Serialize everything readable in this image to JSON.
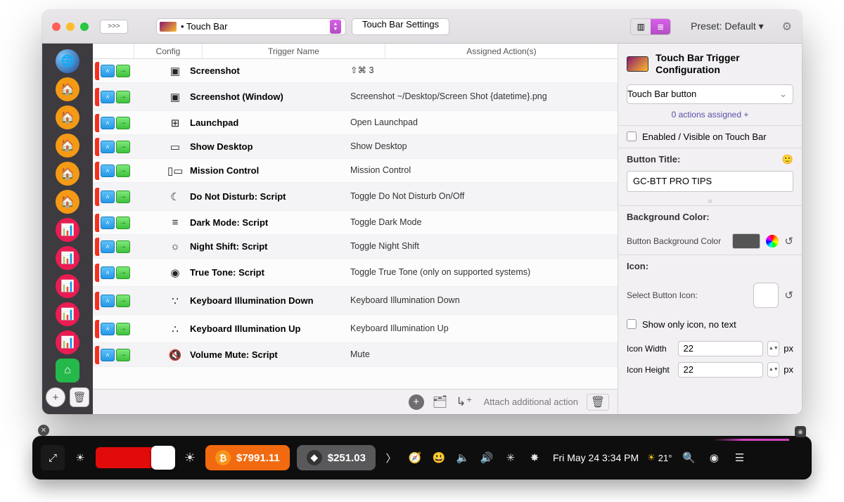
{
  "titlebar": {
    "show_more": ">>>",
    "touchbar_dropdown": "• Touch Bar",
    "settings_button": "Touch Bar Settings",
    "preset_label": "Preset: Default ▾"
  },
  "columns": {
    "config": "Config",
    "trigger": "Trigger Name",
    "actions": "Assigned Action(s)"
  },
  "triggers": [
    {
      "icon": "▣",
      "name": "Screenshot",
      "action": "⇧⌘ 3"
    },
    {
      "icon": "▣",
      "name": "Screenshot (Window)",
      "action": "Screenshot ~/Desktop/Screen Shot {datetime}.png",
      "tall": true
    },
    {
      "icon": "⊞",
      "name": "Launchpad",
      "action": "Open Launchpad"
    },
    {
      "icon": "▭",
      "name": "Show Desktop",
      "action": "Show Desktop"
    },
    {
      "icon": "▯▭",
      "name": "Mission Control",
      "action": "Mission Control"
    },
    {
      "icon": "☾",
      "name": "Do Not Disturb: Script",
      "action": "Toggle Do Not Disturb On/Off",
      "tall": true
    },
    {
      "icon": "≡",
      "name": "Dark Mode: Script",
      "action": "Toggle Dark Mode"
    },
    {
      "icon": "☼",
      "name": "Night Shift: Script",
      "action": "Toggle Night Shift"
    },
    {
      "icon": "◉",
      "name": "True Tone: Script",
      "action": "Toggle True Tone (only on supported systems)",
      "tall": true
    },
    {
      "icon": "∵",
      "name": "Keyboard Illumination Down",
      "action": "Keyboard Illumination Down",
      "tall": true
    },
    {
      "icon": "∴",
      "name": "Keyboard Illumination Up",
      "action": "Keyboard Illumination Up",
      "tall": true
    },
    {
      "icon": "🔇",
      "name": "Volume Mute: Script",
      "action": "Mute"
    }
  ],
  "bottom_bar": {
    "attach": "Attach additional action"
  },
  "inspector": {
    "title": "Touch Bar Trigger Configuration",
    "type_dropdown": "Touch Bar button",
    "actions_link": "0 actions assigned +",
    "enabled_checkbox": "Enabled / Visible on Touch Bar",
    "button_title_label": "Button Title:",
    "button_title_value": "GC-BTT PRO TIPS",
    "bg_section": "Background Color:",
    "bg_color_label": "Button Background Color",
    "icon_section": "Icon:",
    "select_icon_label": "Select Button Icon:",
    "show_only_icon": "Show only icon, no text",
    "icon_width_label": "Icon Width",
    "icon_width_value": "22",
    "icon_height_label": "Icon Height",
    "icon_height_value": "22",
    "px": "px"
  },
  "touchbar": {
    "btc_price": "$7991.11",
    "eth_price": "$251.03",
    "clock": "Fri May 24 3:34 PM",
    "temp": "21°"
  }
}
